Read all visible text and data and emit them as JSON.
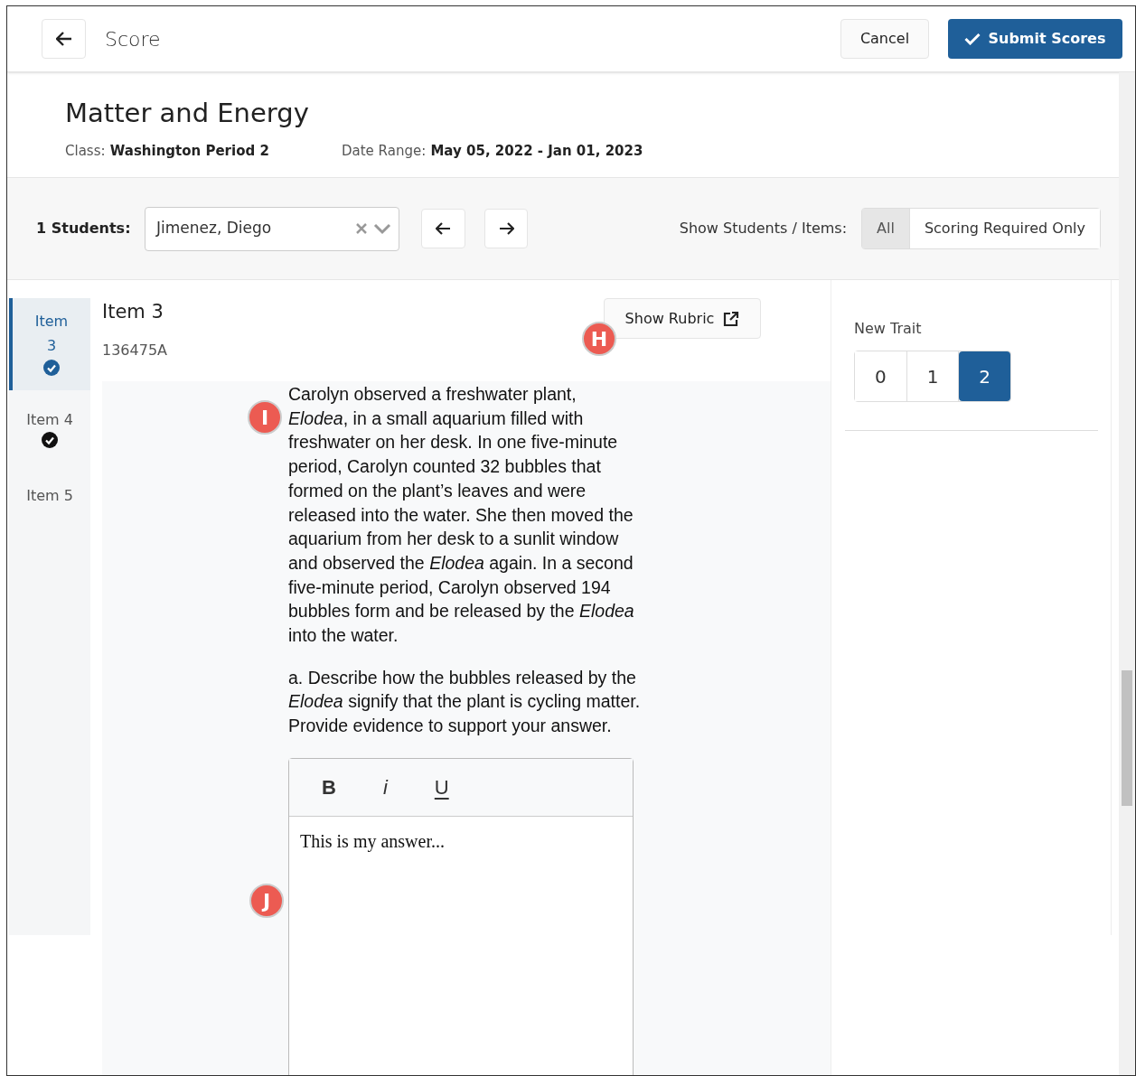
{
  "top_bar": {
    "title": "Score",
    "cancel": "Cancel",
    "submit": "Submit Scores"
  },
  "assessment": {
    "title": "Matter and Energy",
    "class_label": "Class:",
    "class_value": "Washington Period 2",
    "date_label": "Date Range:",
    "date_value": "May 05, 2022 - Jan 01, 2023"
  },
  "filters": {
    "students_label": "1 Students:",
    "student": "Jimenez, Diego",
    "show_label": "Show Students",
    "separator": "/",
    "show_label_2": "Items:",
    "options": [
      {
        "label": "All",
        "selected": true
      },
      {
        "label": "Scoring Required Only",
        "selected": false
      }
    ]
  },
  "items_nav": [
    {
      "label": "Item 3",
      "selected": true,
      "checked": true
    },
    {
      "label": "Item 4",
      "selected": false,
      "checked": true
    },
    {
      "label": "Item 5",
      "selected": false,
      "checked": false
    }
  ],
  "item": {
    "title": "Item 3",
    "code": "136475A",
    "rubric_button": "Show Rubric",
    "passage": [
      "Carolyn observed a freshwater plant, *Elodea*, in a small aquarium filled with freshwater on her desk. In one five-minute period, Carolyn counted 32 bubbles that formed on the plant’s leaves and were released into the water. She then moved the aquarium from her desk to a sunlit window and observed the *Elodea* again. In a second five-minute period, Carolyn observed 194 bubbles form and be released by the *Elodea* into the water.",
      "a. Describe how the bubbles released by the *Elodea* signify that the plant is cycling matter. Provide evidence to support your answer."
    ],
    "editor": {
      "tools": [
        {
          "kind": "bold",
          "label": "B"
        },
        {
          "kind": "italic",
          "label": "i"
        },
        {
          "kind": "underline",
          "label": "U"
        }
      ],
      "value": "This is my answer..."
    }
  },
  "trait": {
    "name": "New Trait",
    "scores": [
      {
        "label": "0",
        "selected": false
      },
      {
        "label": "1",
        "selected": false
      },
      {
        "label": "2",
        "selected": true
      }
    ]
  },
  "callouts": [
    {
      "label": "H"
    },
    {
      "label": "I"
    },
    {
      "label": "J"
    }
  ]
}
